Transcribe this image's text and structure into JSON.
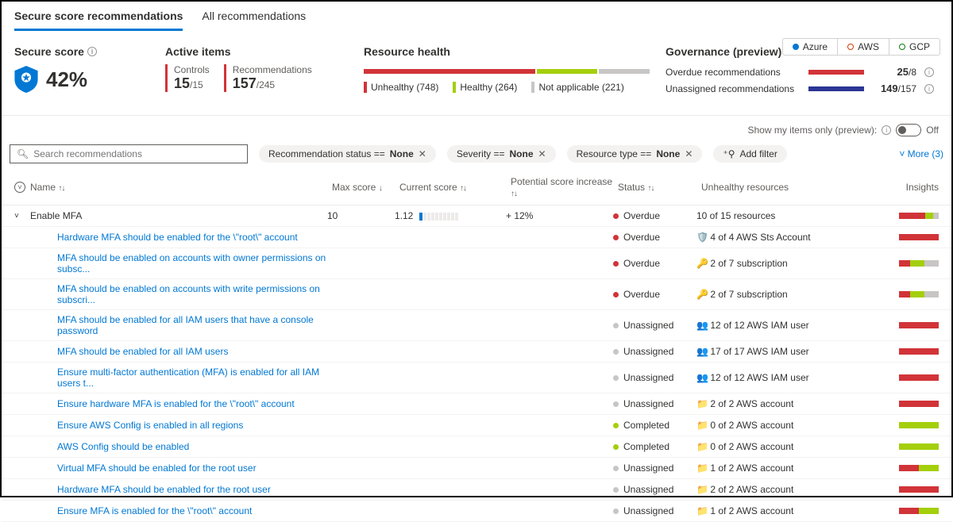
{
  "tabs": {
    "secure": "Secure score recommendations",
    "all": "All recommendations"
  },
  "clouds": {
    "azure": "Azure",
    "aws": "AWS",
    "gcp": "GCP"
  },
  "score": {
    "label": "Secure score",
    "value": "42%"
  },
  "active": {
    "label": "Active items",
    "controls_label": "Controls",
    "controls_val": "15",
    "controls_total": "/15",
    "rec_label": "Recommendations",
    "rec_val": "157",
    "rec_total": "/245"
  },
  "health": {
    "label": "Resource health",
    "unhealthy": "Unhealthy (748)",
    "healthy": "Healthy (264)",
    "na": "Not applicable (221)"
  },
  "gov": {
    "label": "Governance (preview)",
    "overdue": "Overdue recommendations",
    "overdue_v": "25",
    "overdue_t": "/8",
    "unassigned": "Unassigned recommendations",
    "unassigned_v": "149",
    "unassigned_t": "/157"
  },
  "options": {
    "show": "Show my items only (preview):",
    "state": "Off"
  },
  "search": {
    "placeholder": "Search recommendations"
  },
  "pills": {
    "p1a": "Recommendation status == ",
    "p1b": "None",
    "p2a": "Severity == ",
    "p2b": "None",
    "p3a": "Resource type == ",
    "p3b": "None",
    "add": "Add filter"
  },
  "more": "More (3)",
  "headers": {
    "name": "Name",
    "max": "Max score",
    "cur": "Current score",
    "pot": "Potential score increase",
    "stat": "Status",
    "res": "Unhealthy resources",
    "ins": "Insights"
  },
  "group": {
    "name": "Enable MFA",
    "max": "10",
    "cur": "1.12",
    "pot": "+ 12%",
    "stat": "Overdue",
    "res": "10 of 15 resources"
  },
  "rows": [
    {
      "name": "Hardware MFA should be enabled for the \\\"root\\\" account",
      "status": "Overdue",
      "dot": "red",
      "icn": "🛡️",
      "res": "4 of 4 AWS Sts Account",
      "bar": [
        1,
        0,
        0
      ]
    },
    {
      "name": "MFA should be enabled on accounts with owner permissions on subsc...",
      "status": "Overdue",
      "dot": "red",
      "icn": "🔑",
      "res": "2 of 7 subscription",
      "bar": [
        0.28,
        0.36,
        0.36
      ]
    },
    {
      "name": "MFA should be enabled on accounts with write permissions on subscri...",
      "status": "Overdue",
      "dot": "red",
      "icn": "🔑",
      "res": "2 of 7 subscription",
      "bar": [
        0.28,
        0.36,
        0.36
      ]
    },
    {
      "name": "MFA should be enabled for all IAM users that have a console password",
      "status": "Unassigned",
      "dot": "gray",
      "icn": "👥",
      "res": "12 of 12 AWS IAM user",
      "bar": [
        1,
        0,
        0
      ]
    },
    {
      "name": "MFA should be enabled for all IAM users",
      "status": "Unassigned",
      "dot": "gray",
      "icn": "👥",
      "res": "17 of 17 AWS IAM user",
      "bar": [
        1,
        0,
        0
      ]
    },
    {
      "name": "Ensure multi-factor authentication (MFA) is enabled for all IAM users t...",
      "status": "Unassigned",
      "dot": "gray",
      "icn": "👥",
      "res": "12 of 12 AWS IAM user",
      "bar": [
        1,
        0,
        0
      ]
    },
    {
      "name": "Ensure hardware MFA is enabled for the \\\"root\\\" account",
      "status": "Unassigned",
      "dot": "gray",
      "icn": "📁",
      "res": "2 of 2 AWS account",
      "bar": [
        1,
        0,
        0
      ]
    },
    {
      "name": "Ensure AWS Config is enabled in all regions",
      "status": "Completed",
      "dot": "green",
      "icn": "📁",
      "res": "0 of 2 AWS account",
      "bar": [
        0,
        1,
        0
      ]
    },
    {
      "name": "AWS Config should be enabled",
      "status": "Completed",
      "dot": "green",
      "icn": "📁",
      "res": "0 of 2 AWS account",
      "bar": [
        0,
        1,
        0
      ]
    },
    {
      "name": "Virtual MFA should be enabled for the root user",
      "status": "Unassigned",
      "dot": "gray",
      "icn": "📁",
      "res": "1 of 2 AWS account",
      "bar": [
        0.5,
        0.5,
        0
      ]
    },
    {
      "name": "Hardware MFA should be enabled for the root user",
      "status": "Unassigned",
      "dot": "gray",
      "icn": "📁",
      "res": "2 of 2 AWS account",
      "bar": [
        1,
        0,
        0
      ]
    },
    {
      "name": "Ensure MFA is enabled for the \\\"root\\\" account",
      "status": "Unassigned",
      "dot": "gray",
      "icn": "📁",
      "res": "1 of 2 AWS account",
      "bar": [
        0.5,
        0.5,
        0
      ]
    }
  ]
}
